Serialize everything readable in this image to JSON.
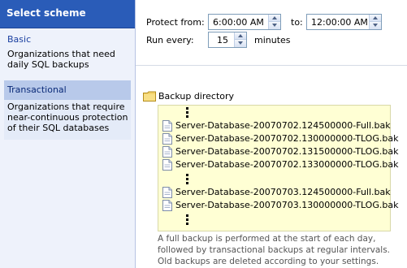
{
  "left_panel": {
    "header": "Select scheme",
    "schemes": [
      {
        "title": "Basic",
        "description": "Organizations that need daily SQL backups"
      },
      {
        "title": "Transactional",
        "description": "Organizations that require near-continuous protection of their SQL databases"
      }
    ]
  },
  "controls": {
    "protect_from_label": "Protect from:",
    "protect_from_value": "6:00:00 AM",
    "to_label": "to:",
    "to_value": "12:00:00 AM",
    "run_every_label": "Run every:",
    "run_every_value": "15",
    "run_every_unit": "minutes"
  },
  "tree": {
    "folder_label": "Backup directory",
    "files": [
      "Server-Database-20070702.124500000-Full.bak",
      "Server-Database-20070702.130000000-TLOG.bak",
      "Server-Database-20070702.131500000-TLOG.bak",
      "Server-Database-20070702.133000000-TLOG.bak",
      "Server-Database-20070703.124500000-Full.bak",
      "Server-Database-20070703.130000000-TLOG.bak"
    ]
  },
  "caption": {
    "line1": "A full backup is performed at the start of each day,",
    "line2": "followed by transactional backups at regular intervals.",
    "line3": "Old backups are deleted according to your settings."
  },
  "colors": {
    "header_bg": "#2a5cb8",
    "selected_bg": "#b8c9ea",
    "filebox_bg": "#ffffd4"
  }
}
